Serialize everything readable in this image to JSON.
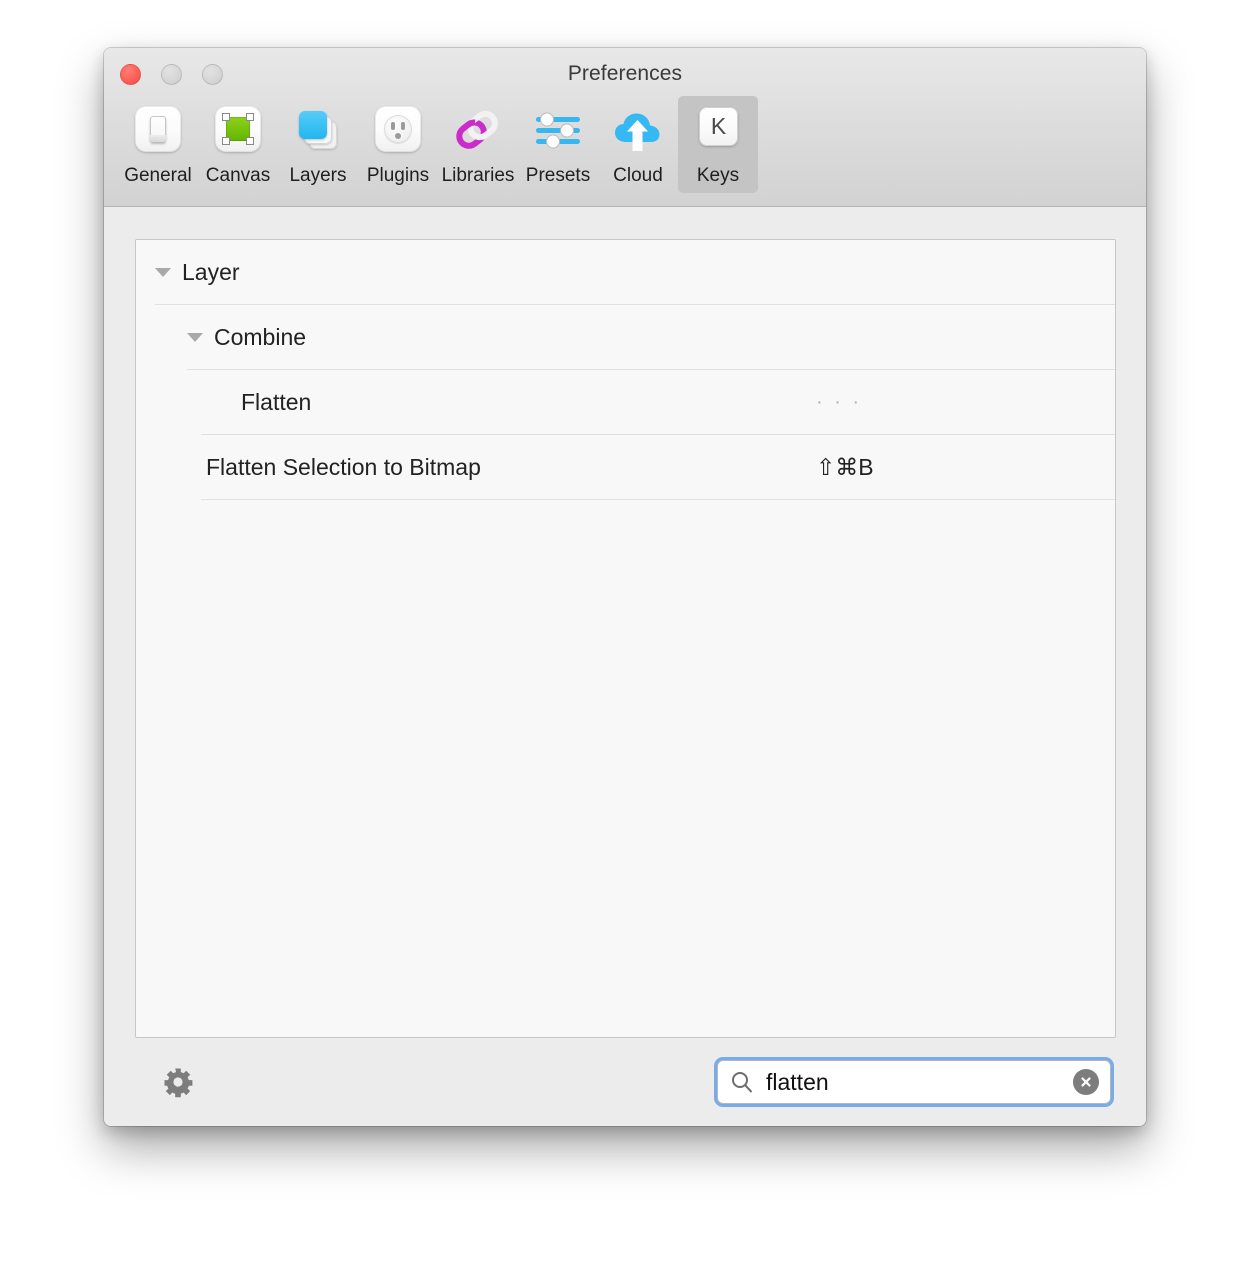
{
  "window": {
    "title": "Preferences",
    "traffic_lights": [
      "close",
      "minimize",
      "maximize"
    ]
  },
  "toolbar": {
    "items": [
      {
        "label": "General",
        "icon": "toggle-switch-icon",
        "selected": false
      },
      {
        "label": "Canvas",
        "icon": "green-square-selection-icon",
        "selected": false
      },
      {
        "label": "Layers",
        "icon": "stacked-layers-icon",
        "selected": false
      },
      {
        "label": "Plugins",
        "icon": "power-outlet-icon",
        "selected": false
      },
      {
        "label": "Libraries",
        "icon": "chain-link-icon",
        "selected": false
      },
      {
        "label": "Presets",
        "icon": "sliders-icon",
        "selected": false
      },
      {
        "label": "Cloud",
        "icon": "cloud-upload-icon",
        "selected": false
      },
      {
        "label": "Keys",
        "icon": "keyboard-key-icon",
        "selected": true,
        "key_glyph": "K"
      }
    ]
  },
  "shortcuts_list": {
    "rows": [
      {
        "label": "Layer",
        "shortcut": "",
        "level": 0,
        "expanded": true,
        "has_arrow": true
      },
      {
        "label": "Combine",
        "shortcut": "",
        "level": 1,
        "expanded": true,
        "has_arrow": true
      },
      {
        "label": "Flatten",
        "shortcut": "· · ·",
        "level": 2,
        "has_arrow": false,
        "shortcut_is_placeholder": true
      },
      {
        "label": "Flatten Selection to Bitmap",
        "shortcut": "⇧⌘B",
        "level": 1,
        "has_arrow": false,
        "shortcut_is_placeholder": false
      }
    ]
  },
  "bottom_bar": {
    "gear_label": "Settings",
    "search": {
      "value": "flatten",
      "placeholder": "Search",
      "clear_label": "Clear search"
    }
  },
  "colors": {
    "window_bg": "#ececec",
    "toolbar_bg": "#dcdcdc",
    "selected_tab_bg": "#c4c4c4",
    "list_bg": "#f8f8f8",
    "focus_ring": "#64a0eb",
    "close_button": "#ff5f57",
    "layers_blue": "#22b6f0",
    "canvas_green": "#63b500",
    "libraries_magenta": "#cc2bcc",
    "cloud_blue": "#29b5f0"
  }
}
